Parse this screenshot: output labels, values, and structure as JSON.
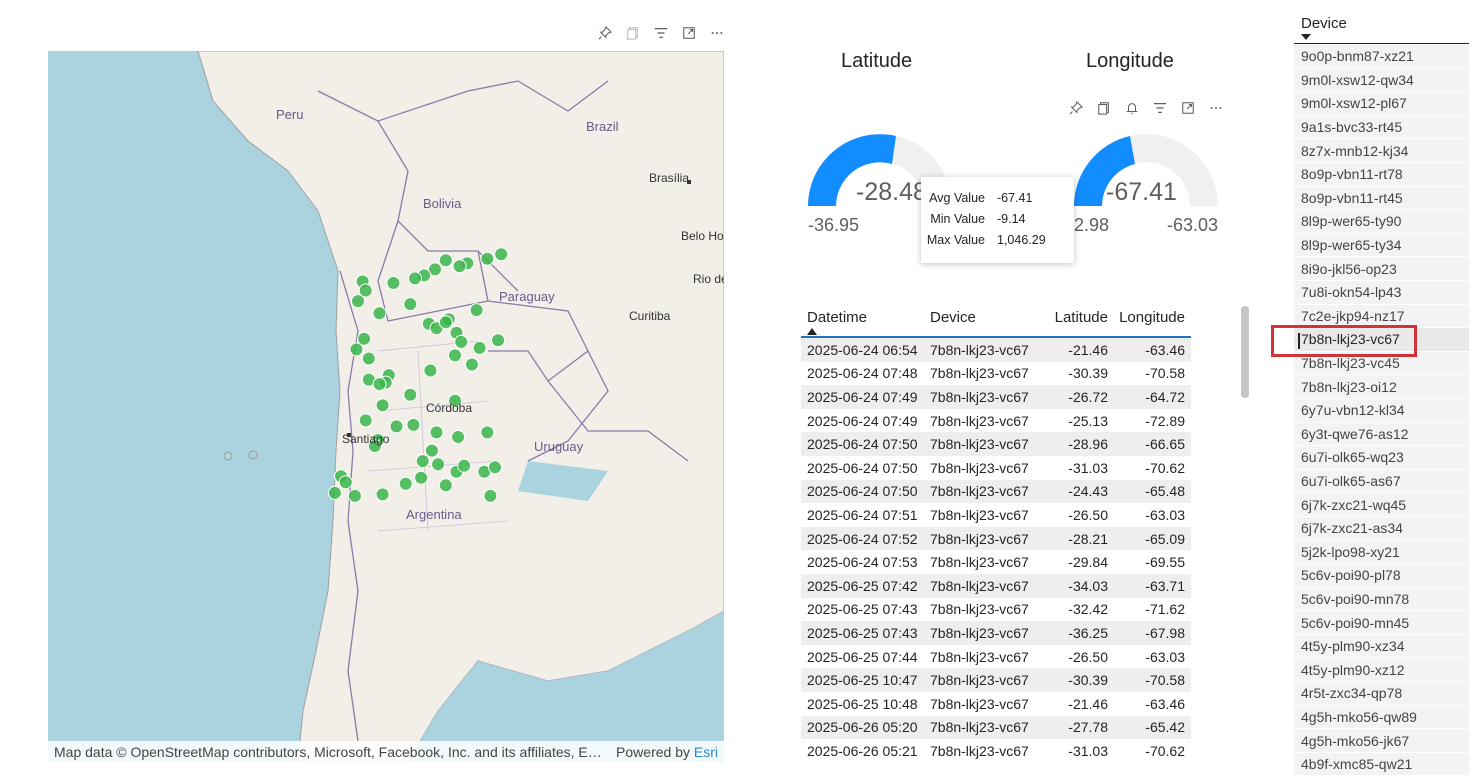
{
  "map_visual": {
    "toolbar_icons": [
      "pin-icon",
      "copy-icon",
      "filter-icon",
      "focus-mode-icon",
      "more-options-icon"
    ],
    "labels": {
      "peru": "Peru",
      "brazil": "Brazil",
      "bolivia": "Bolivia",
      "brasilia": "Brasília",
      "belo": "Belo Ho",
      "rio": "Rio de",
      "paraguay": "Paraguay",
      "curitiba": "Curitiba",
      "cordoba": "Córdoba",
      "santiago": "Santiago",
      "uruguay": "Uruguay",
      "argentina": "Argentina"
    },
    "credit": "Map data © OpenStreetMap contributors, Microsoft, Facebook, Inc. and its affiliates, Esri Community Maps contributors, Map layer by Esri",
    "powered_by": "Powered by",
    "esri": "Esri",
    "colors": {
      "water": "#aad3df",
      "land": "#f2efe9",
      "marker": "#39b54a"
    }
  },
  "gauges": {
    "latitude": {
      "title": "Latitude",
      "value": "-28.48",
      "min_label": "-36.95"
    },
    "longitude": {
      "title": "Longitude",
      "value": "-67.41",
      "min_label": "2.98",
      "max_label": "-63.03"
    },
    "toolbar_icons": [
      "pin-icon",
      "copy-icon",
      "bell-icon",
      "filter-icon",
      "focus-mode-icon",
      "more-options-icon"
    ],
    "colors": {
      "fill": "#118dff",
      "track": "#f0f0f0"
    }
  },
  "tooltip": {
    "rows": [
      {
        "k": "Avg Value",
        "v": "-67.41"
      },
      {
        "k": "Min Value",
        "v": "-9.14"
      },
      {
        "k": "Max Value",
        "v": "1,046.29"
      }
    ]
  },
  "table": {
    "columns": [
      "Datetime",
      "Device",
      "Latitude",
      "Longitude"
    ],
    "rows": [
      [
        "2025-06-24 06:54",
        "7b8n-lkj23-vc67",
        "-21.46",
        "-63.46"
      ],
      [
        "2025-06-24 07:48",
        "7b8n-lkj23-vc67",
        "-30.39",
        "-70.58"
      ],
      [
        "2025-06-24 07:49",
        "7b8n-lkj23-vc67",
        "-26.72",
        "-64.72"
      ],
      [
        "2025-06-24 07:49",
        "7b8n-lkj23-vc67",
        "-25.13",
        "-72.89"
      ],
      [
        "2025-06-24 07:50",
        "7b8n-lkj23-vc67",
        "-28.96",
        "-66.65"
      ],
      [
        "2025-06-24 07:50",
        "7b8n-lkj23-vc67",
        "-31.03",
        "-70.62"
      ],
      [
        "2025-06-24 07:50",
        "7b8n-lkj23-vc67",
        "-24.43",
        "-65.48"
      ],
      [
        "2025-06-24 07:51",
        "7b8n-lkj23-vc67",
        "-26.50",
        "-63.03"
      ],
      [
        "2025-06-24 07:52",
        "7b8n-lkj23-vc67",
        "-28.21",
        "-65.09"
      ],
      [
        "2025-06-24 07:53",
        "7b8n-lkj23-vc67",
        "-29.84",
        "-69.55"
      ],
      [
        "2025-06-25 07:42",
        "7b8n-lkj23-vc67",
        "-34.03",
        "-63.71"
      ],
      [
        "2025-06-25 07:43",
        "7b8n-lkj23-vc67",
        "-32.42",
        "-71.62"
      ],
      [
        "2025-06-25 07:43",
        "7b8n-lkj23-vc67",
        "-36.25",
        "-67.98"
      ],
      [
        "2025-06-25 07:44",
        "7b8n-lkj23-vc67",
        "-26.50",
        "-63.03"
      ],
      [
        "2025-06-25 10:47",
        "7b8n-lkj23-vc67",
        "-30.39",
        "-70.58"
      ],
      [
        "2025-06-25 10:48",
        "7b8n-lkj23-vc67",
        "-21.46",
        "-63.46"
      ],
      [
        "2025-06-26 05:20",
        "7b8n-lkj23-vc67",
        "-27.78",
        "-65.42"
      ],
      [
        "2025-06-26 05:21",
        "7b8n-lkj23-vc67",
        "-31.03",
        "-70.62"
      ]
    ]
  },
  "slicer": {
    "title": "Device",
    "selected": "7b8n-lkj23-vc67",
    "items": [
      "9o0p-bnm87-xz21",
      "9m0l-xsw12-qw34",
      "9m0l-xsw12-pl67",
      "9a1s-bvc33-rt45",
      "8z7x-mnb12-kj34",
      "8o9p-vbn11-rt78",
      "8o9p-vbn11-rt45",
      "8l9p-wer65-ty90",
      "8l9p-wer65-ty34",
      "8i9o-jkl56-op23",
      "7u8i-okn54-lp43",
      "7c2e-jkp94-nz17",
      "7b8n-lkj23-vc67",
      "7b8n-lkj23-vc45",
      "7b8n-lkj23-oi12",
      "6y7u-vbn12-kl34",
      "6y3t-qwe76-as12",
      "6u7i-olk65-wq23",
      "6u7i-olk65-as67",
      "6j7k-zxc21-wq45",
      "6j7k-zxc21-as34",
      "5j2k-lpo98-xy21",
      "5c6v-poi90-pl78",
      "5c6v-poi90-mn78",
      "5c6v-poi90-mn45",
      "4t5y-plm90-xz34",
      "4t5y-plm90-xz12",
      "4r5t-zxc34-qp78",
      "4g5h-mko56-qw89",
      "4g5h-mko56-jk67",
      "4b9f-xmc85-qw21"
    ]
  }
}
